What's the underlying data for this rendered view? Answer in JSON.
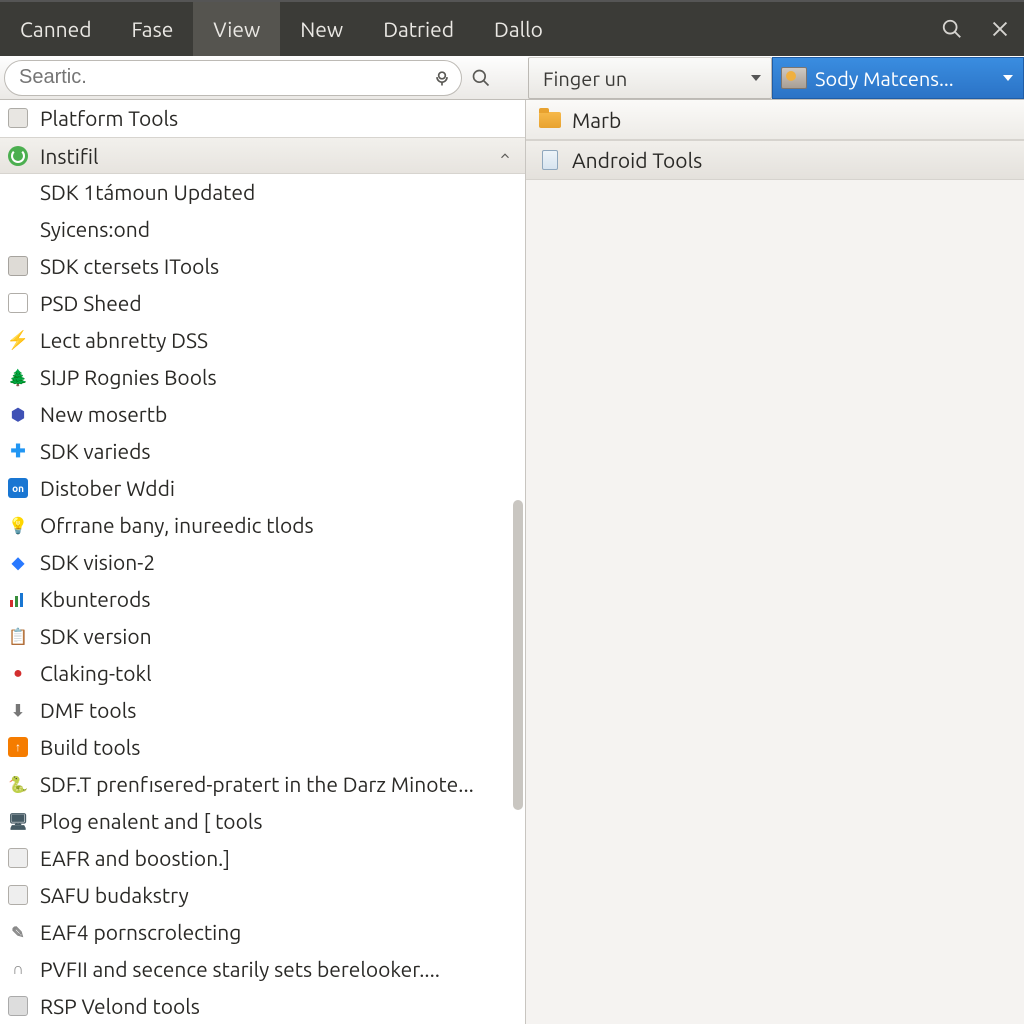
{
  "menubar": {
    "items": [
      "Canned",
      "Fase",
      "View",
      "New",
      "Datried",
      "Dallo"
    ],
    "active_index": 2
  },
  "search": {
    "placeholder": "Seartic."
  },
  "dropdowns": {
    "filter": "Finger un",
    "profile": "Sody Matcens..."
  },
  "left_items": [
    {
      "icon": "disk",
      "label": "Platform Tools"
    },
    {
      "icon": "refresh",
      "label": "Instifil",
      "selected": true,
      "expandable": true
    },
    {
      "icon": "",
      "label": "SDK 1támoun Updated",
      "indent": true
    },
    {
      "icon": "",
      "label": "Syicens:ond",
      "indent": true
    },
    {
      "icon": "box",
      "label": "SDK ctersets ITools"
    },
    {
      "icon": "doc",
      "label": "PSD Sheed"
    },
    {
      "icon": "bolt",
      "label": "Lect abnretty DSS"
    },
    {
      "icon": "tree",
      "label": "SIJP Rognies Bools"
    },
    {
      "icon": "shield",
      "label": "New mosertb"
    },
    {
      "icon": "puzzle",
      "label": "SDK varieds"
    },
    {
      "icon": "badge",
      "label": "Distober Wddi"
    },
    {
      "icon": "bulb",
      "label": "Ofrrane bany, inureedic tlods"
    },
    {
      "icon": "diamond",
      "label": "SDK vision-2"
    },
    {
      "icon": "bars",
      "label": "Kbunterods"
    },
    {
      "icon": "clip",
      "label": "SDK version"
    },
    {
      "icon": "warn",
      "label": "Claking-tokl"
    },
    {
      "icon": "down",
      "label": "DMF tools"
    },
    {
      "icon": "lock",
      "label": "Build tools"
    },
    {
      "icon": "py",
      "label": "SDF.T prenfısered-pratert in the Darz Minote..."
    },
    {
      "icon": "mon",
      "label": "Plog enalent and [ tools"
    },
    {
      "icon": "page",
      "label": "EAFR and boostion.]"
    },
    {
      "icon": "page",
      "label": "SAFU budakstry"
    },
    {
      "icon": "pen",
      "label": "EAF4 pornscrolecting"
    },
    {
      "icon": "arch",
      "label": "PVFII and secence starily sets berelooker...."
    },
    {
      "icon": "srv",
      "label": "RSP Velond tools"
    }
  ],
  "right_items": [
    {
      "icon": "folder",
      "label": "Marb",
      "header": true
    },
    {
      "icon": "file",
      "label": "Android Tools",
      "selected": true
    }
  ]
}
